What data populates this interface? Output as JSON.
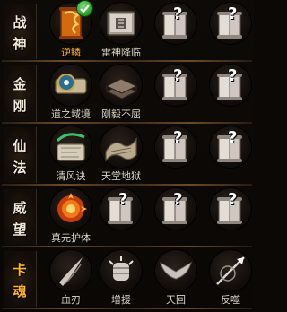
{
  "categories": [
    {
      "name_top": "战",
      "name_bottom": "神",
      "slots": [
        {
          "label": "逆鳞",
          "icon": "dragon-scale-scroll-icon",
          "unlocked": true,
          "active": true,
          "checked": true
        },
        {
          "label": "雷神降临",
          "icon": "thunder-tome-icon",
          "unlocked": true,
          "active": false,
          "checked": false
        },
        {
          "label": "",
          "icon": "locked-scroll-icon",
          "unlocked": false,
          "mark": "?"
        },
        {
          "label": "",
          "icon": "locked-scroll-icon",
          "unlocked": false,
          "mark": "?"
        }
      ]
    },
    {
      "name_top": "金",
      "name_bottom": "刚",
      "slots": [
        {
          "label": "道之域境",
          "icon": "eye-scroll-icon",
          "unlocked": true,
          "active": false
        },
        {
          "label": "刚毅不屈",
          "icon": "stone-book-icon",
          "unlocked": true,
          "active": false
        },
        {
          "label": "",
          "icon": "locked-scroll-icon",
          "unlocked": false,
          "mark": "?"
        },
        {
          "label": "",
          "icon": "locked-scroll-icon",
          "unlocked": false,
          "mark": "?"
        }
      ]
    },
    {
      "name_top": "仙",
      "name_bottom": "法",
      "slots": [
        {
          "label": "清风诀",
          "icon": "wind-scroll-icon",
          "unlocked": true,
          "active": false
        },
        {
          "label": "天堂地狱",
          "icon": "open-scroll-icon",
          "unlocked": true,
          "active": false
        },
        {
          "label": "",
          "icon": "locked-scroll-icon",
          "unlocked": false,
          "mark": "?"
        },
        {
          "label": "",
          "icon": "locked-scroll-icon",
          "unlocked": false,
          "mark": "?"
        }
      ]
    },
    {
      "name_top": "威",
      "name_bottom": "望",
      "slots": [
        {
          "label": "真元护体",
          "icon": "fire-orb-icon",
          "unlocked": true,
          "active": false
        },
        {
          "label": "",
          "icon": "locked-scroll-icon",
          "unlocked": false,
          "mark": "?"
        },
        {
          "label": "",
          "icon": "locked-scroll-icon",
          "unlocked": false,
          "mark": "?"
        },
        {
          "label": "",
          "icon": "locked-scroll-icon",
          "unlocked": false,
          "mark": "?"
        }
      ]
    },
    {
      "name_top": "卡",
      "name_bottom": "魂",
      "gold": true,
      "slots": [
        {
          "label": "血刃",
          "icon": "blood-blade-icon",
          "unlocked": true,
          "active": false
        },
        {
          "label": "增援",
          "icon": "fist-icon",
          "unlocked": true,
          "active": false
        },
        {
          "label": "天回",
          "icon": "wings-icon",
          "unlocked": true,
          "active": false
        },
        {
          "label": "反噬",
          "icon": "spear-burst-icon",
          "unlocked": true,
          "active": false
        }
      ]
    }
  ],
  "colors": {
    "active_label": "#ffb33a",
    "label": "#ddd4c2",
    "category_gold": "#ffb42a"
  }
}
